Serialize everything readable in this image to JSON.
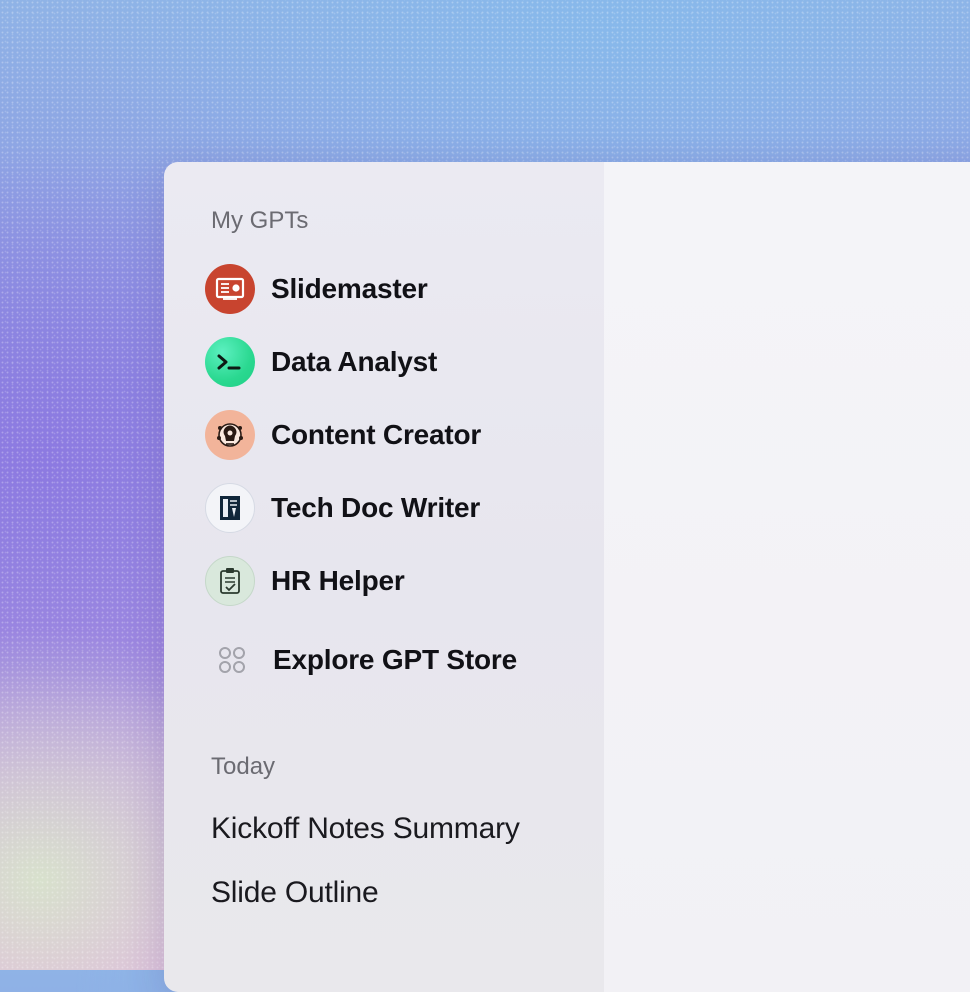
{
  "sidebar": {
    "my_gpts_label": "My GPTs",
    "gpts": [
      {
        "label": "Slidemaster",
        "icon": "slides-icon",
        "color": "#c8442f"
      },
      {
        "label": "Data Analyst",
        "icon": "terminal-icon",
        "color": "#3fe0a0"
      },
      {
        "label": "Content Creator",
        "icon": "idea-head-icon",
        "color": "#f2b49a"
      },
      {
        "label": "Tech Doc Writer",
        "icon": "document-pen-icon",
        "color": "#f3f4f8"
      },
      {
        "label": "HR Helper",
        "icon": "clipboard-check-icon",
        "color": "#d9e8dc"
      }
    ],
    "explore": {
      "label": "Explore GPT Store",
      "icon": "grid-dots-icon"
    },
    "today_label": "Today",
    "chats": [
      "Kickoff Notes Summary",
      "Slide Outline"
    ]
  }
}
